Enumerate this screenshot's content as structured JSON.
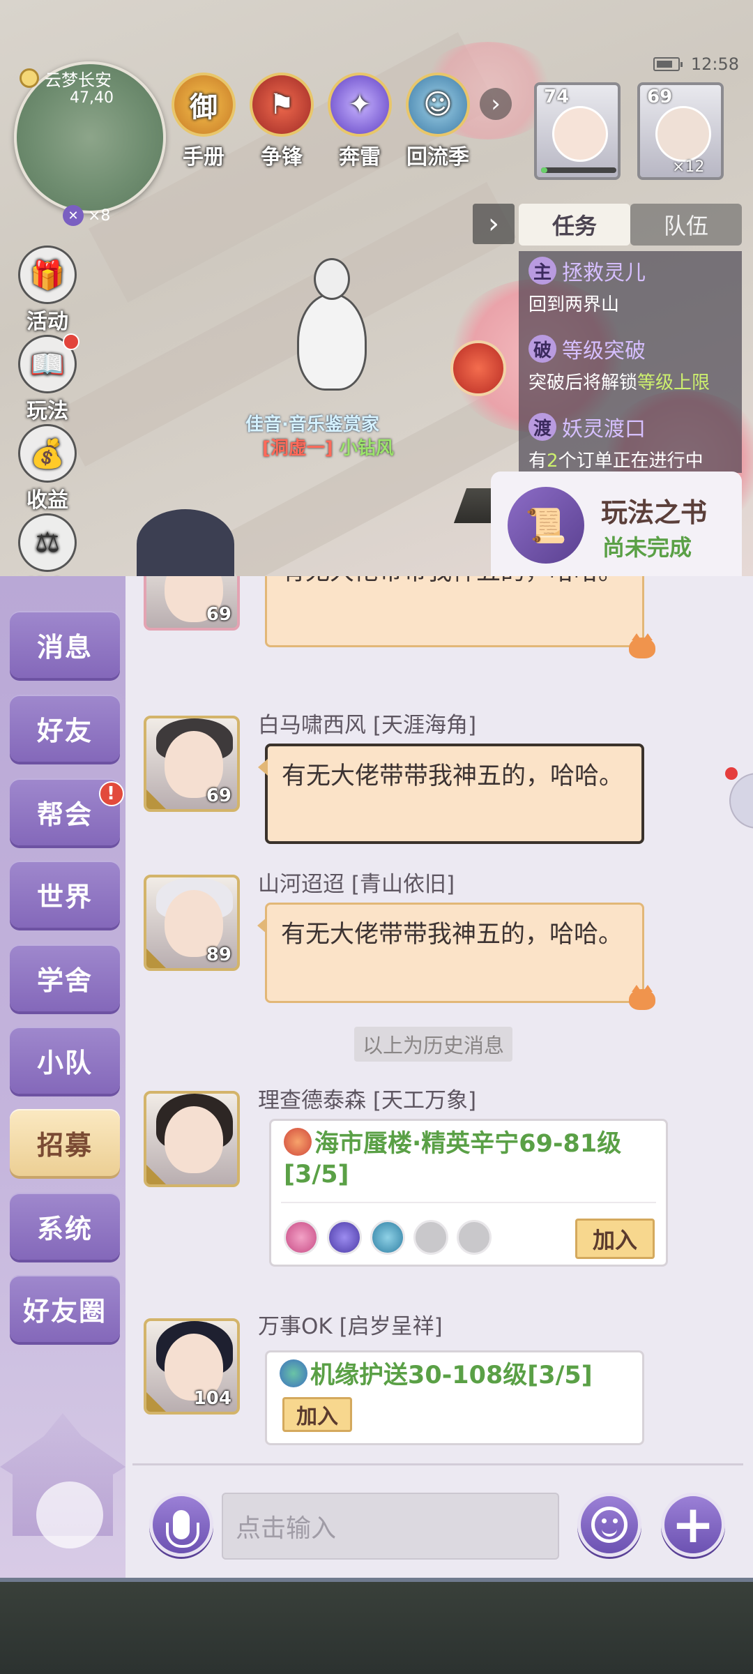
{
  "status": {
    "time": "12:58"
  },
  "map": {
    "location": "云梦长安",
    "coords": "47,40",
    "count": "×8"
  },
  "features": [
    {
      "label": "手册",
      "icon": "handbook-icon"
    },
    {
      "label": "争锋",
      "icon": "contest-flag-icon"
    },
    {
      "label": "奔雷",
      "icon": "thunder-crystal-icon"
    },
    {
      "label": "回流季",
      "icon": "return-season-icon"
    }
  ],
  "party": [
    {
      "level": "74"
    },
    {
      "level": "69",
      "multiplier": "×12"
    }
  ],
  "tabs": {
    "task": "任务",
    "team": "队伍"
  },
  "quests": [
    {
      "type": "主",
      "title": "拯救灵儿",
      "desc": "回到两界山"
    },
    {
      "type": "破",
      "title": "等级突破",
      "desc_prefix": "突破后将解锁",
      "desc_highlight": "等级上限"
    },
    {
      "type": "渡",
      "title": "妖灵渡口",
      "desc_prefix": "有",
      "desc_highlight": "2",
      "desc_suffix": "个订单正在进行中"
    }
  ],
  "playbook": {
    "title": "玩法之书",
    "status": "尚未完成"
  },
  "side_icons": [
    {
      "label": "活动",
      "icon": "activity-gift-icon"
    },
    {
      "label": "玩法",
      "icon": "gameplay-book-icon"
    },
    {
      "label": "收益",
      "icon": "earnings-bag-icon"
    },
    {
      "label": "坊市",
      "icon": "market-scale-icon"
    }
  ],
  "npc": {
    "name": "佳音·音乐鉴赏家",
    "title_a": "[洞虚一]",
    "title_b": "小钻风"
  },
  "channels": [
    {
      "label": "消息"
    },
    {
      "label": "好友"
    },
    {
      "label": "帮会",
      "badge": "!"
    },
    {
      "label": "世界"
    },
    {
      "label": "学舍"
    },
    {
      "label": "小队"
    },
    {
      "label": "招募",
      "active": true
    },
    {
      "label": "系统"
    },
    {
      "label": "好友圈"
    }
  ],
  "messages": [
    {
      "sender": "",
      "level": "69",
      "text": "有无大佬带带我神五的，哈哈。"
    },
    {
      "sender": "白马啸西风 [天涯海角]",
      "level": "69",
      "text": "有无大佬带带我神五的，哈哈。"
    },
    {
      "sender": "山河迢迢 [青山依旧]",
      "level": "89",
      "text": "有无大佬带带我神五的，哈哈。"
    }
  ],
  "history_label": "以上为历史消息",
  "recruit": [
    {
      "sender": "理查德泰森 [天工万象]",
      "title": "海市蜃楼·精英辛宁69-81级[3/5]",
      "join": "加入"
    },
    {
      "sender": "万事OK [启岁呈祥]",
      "level": "104",
      "title": "机缘护送30-108级[3/5]",
      "join": "加入"
    }
  ],
  "input": {
    "placeholder": "点击输入"
  },
  "colors": {
    "accent_purple": "#8468ba",
    "active_gold": "#eccf94",
    "recruit_green": "#5aa046",
    "bubble": "#fbe3c8"
  }
}
